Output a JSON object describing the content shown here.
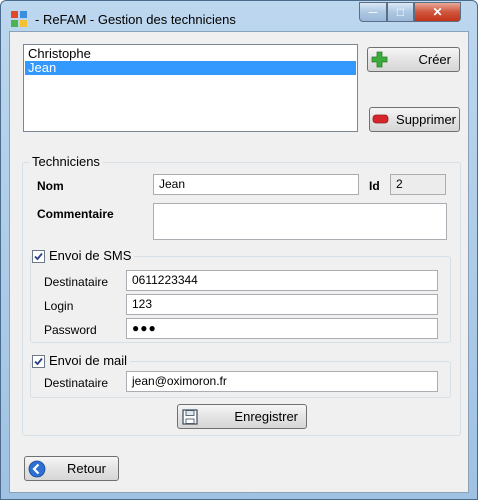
{
  "window": {
    "title": "- ReFAM - Gestion des techniciens",
    "min_glyph": "─",
    "max_glyph": "□",
    "close_glyph": "✕"
  },
  "technicians_list": {
    "items": [
      {
        "label": "Christophe"
      },
      {
        "label": "Jean"
      }
    ],
    "selected": "Jean"
  },
  "buttons": {
    "create": "Créer",
    "delete": "Supprimer",
    "save": "Enregistrer",
    "back": "Retour"
  },
  "techniciens_group": {
    "title": "Techniciens",
    "nom_label": "Nom",
    "nom_value": "Jean",
    "id_label": "Id",
    "id_value": "2",
    "commentaire_label": "Commentaire",
    "commentaire_value": ""
  },
  "sms_group": {
    "title": "Envoi de SMS",
    "checked": true,
    "destinataire_label": "Destinataire",
    "destinataire_value": "0611223344",
    "login_label": "Login",
    "login_value": "123",
    "password_label": "Password",
    "password_value": "●●●"
  },
  "mail_group": {
    "title": "Envoi de mail",
    "checked": true,
    "destinataire_label": "Destinataire",
    "destinataire_value": "jean@oximoron.fr"
  },
  "colors": {
    "selection": "#3399ff",
    "plus_icon": "#3cab3c",
    "minus_icon": "#d4262c",
    "back_icon": "#2d6fd2",
    "close_button": "#c2341b"
  },
  "icons": {
    "create": "plus-icon",
    "delete": "minus-icon",
    "save": "floppy-disk-icon",
    "back": "arrow-left-circle-icon",
    "app": "app-icon"
  }
}
